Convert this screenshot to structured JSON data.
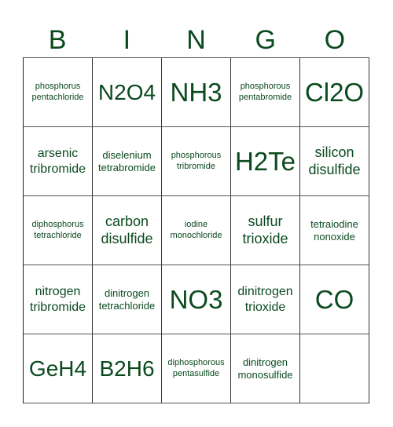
{
  "header": {
    "letters": [
      "B",
      "I",
      "N",
      "G",
      "O"
    ]
  },
  "colors": {
    "text": "#0b4a1f",
    "grid": "#444444",
    "background": "#ffffff"
  },
  "board": {
    "rows": [
      [
        {
          "text": "phosphorus pentachloride",
          "size": "size-xs"
        },
        {
          "text": "N2O4",
          "size": "size-l"
        },
        {
          "text": "NH3",
          "size": "size-xl"
        },
        {
          "text": "phosphorous pentabromide",
          "size": "size-xs"
        },
        {
          "text": "Cl2O",
          "size": "size-xl"
        }
      ],
      [
        {
          "text": "arsenic tribromide",
          "size": "size-m"
        },
        {
          "text": "diselenium tetrabromide",
          "size": "size-s"
        },
        {
          "text": "phosphorous tribromide",
          "size": "size-xs"
        },
        {
          "text": "H2Te",
          "size": "size-xl"
        },
        {
          "text": "silicon disulfide",
          "size": "size-m2"
        }
      ],
      [
        {
          "text": "diphosphorus tetrachloride",
          "size": "size-xs"
        },
        {
          "text": "carbon disulfide",
          "size": "size-m2"
        },
        {
          "text": "iodine monochloride",
          "size": "size-xs"
        },
        {
          "text": "sulfur trioxide",
          "size": "size-m2"
        },
        {
          "text": "tetraiodine nonoxide",
          "size": "size-s"
        }
      ],
      [
        {
          "text": "nitrogen tribromide",
          "size": "size-m"
        },
        {
          "text": "dinitrogen tetrachloride",
          "size": "size-s"
        },
        {
          "text": "NO3",
          "size": "size-xl"
        },
        {
          "text": "dinitrogen trioxide",
          "size": "size-m"
        },
        {
          "text": "CO",
          "size": "size-xl"
        }
      ],
      [
        {
          "text": "GeH4",
          "size": "size-l"
        },
        {
          "text": "B2H6",
          "size": "size-l"
        },
        {
          "text": "diphosphorous pentasulfide",
          "size": "size-xs"
        },
        {
          "text": "dinitrogen monosulfide",
          "size": "size-s"
        },
        {
          "text": "",
          "size": "size-s"
        }
      ]
    ]
  }
}
